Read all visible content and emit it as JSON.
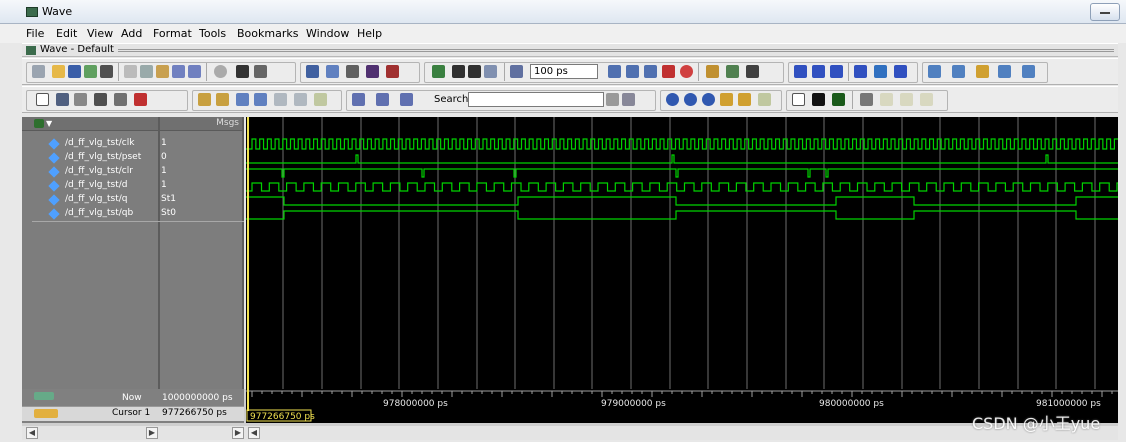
{
  "window": {
    "title": "Wave"
  },
  "menubar": [
    "File",
    "Edit",
    "View",
    "Add",
    "Format",
    "Tools",
    "Bookmarks",
    "Window",
    "Help"
  ],
  "subwindow": {
    "title": "Wave - Default"
  },
  "toolbar": {
    "zoom_value": "100 ps",
    "search_label": "Search:",
    "search_value": ""
  },
  "panel": {
    "header_msgs": "Msgs"
  },
  "signals": [
    {
      "name": "/d_ff_vlg_tst/clk",
      "value": "1"
    },
    {
      "name": "/d_ff_vlg_tst/pset",
      "value": "0"
    },
    {
      "name": "/d_ff_vlg_tst/clr",
      "value": "1"
    },
    {
      "name": "/d_ff_vlg_tst/d",
      "value": "1"
    },
    {
      "name": "/d_ff_vlg_tst/q",
      "value": "St1"
    },
    {
      "name": "/d_ff_vlg_tst/qb",
      "value": "St0"
    }
  ],
  "status": {
    "now_label": "Now",
    "now_value": "1000000000 ps",
    "cursor_label": "Cursor 1",
    "cursor_value": "977266750 ps",
    "cursor_tag": "977266750 ps"
  },
  "time_axis": {
    "ticks": [
      "978000000 ps",
      "979000000 ps",
      "980000000 ps",
      "981000000 ps"
    ]
  },
  "colors": {
    "wave_bg": "#000000",
    "trace": "#00d200",
    "cursor": "#f0e050",
    "gridline": "#6e6e6e",
    "signal_icon": "#4fa0ff"
  },
  "watermark": "CSDN @小王yue"
}
